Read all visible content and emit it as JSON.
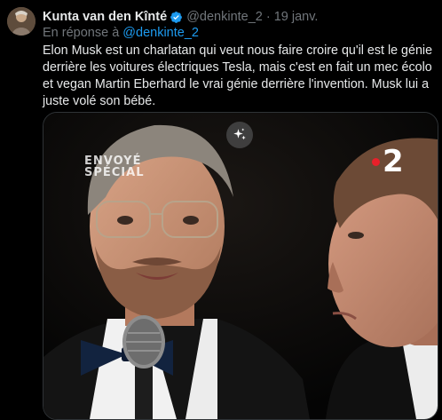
{
  "tweet": {
    "display_name": "Kunta van den Kînté",
    "handle": "@denkinte_2",
    "separator": "·",
    "timestamp": "19 janv.",
    "reply_prefix": "En réponse à",
    "reply_to": "@denkinte_2",
    "text": "Elon Musk est un charlatan qui veut nous faire croire qu'il est le génie derrière les voitures électriques Tesla, mais c'est en fait un mec écolo et vegan Martin Eberhard le vrai génie derrière l'invention. Musk lui a juste volé son bébé."
  },
  "media": {
    "watermark_left": [
      "ENVOYÉ",
      "SPÉCIAL"
    ],
    "watermark_right": "2",
    "action_icon": "sparkle-icon"
  },
  "colors": {
    "background": "#000000",
    "text": "#e7e9ea",
    "secondary": "#71767b",
    "link": "#1d9bf0",
    "verified": "#1d9bf0",
    "france2_red": "#e8202a"
  }
}
